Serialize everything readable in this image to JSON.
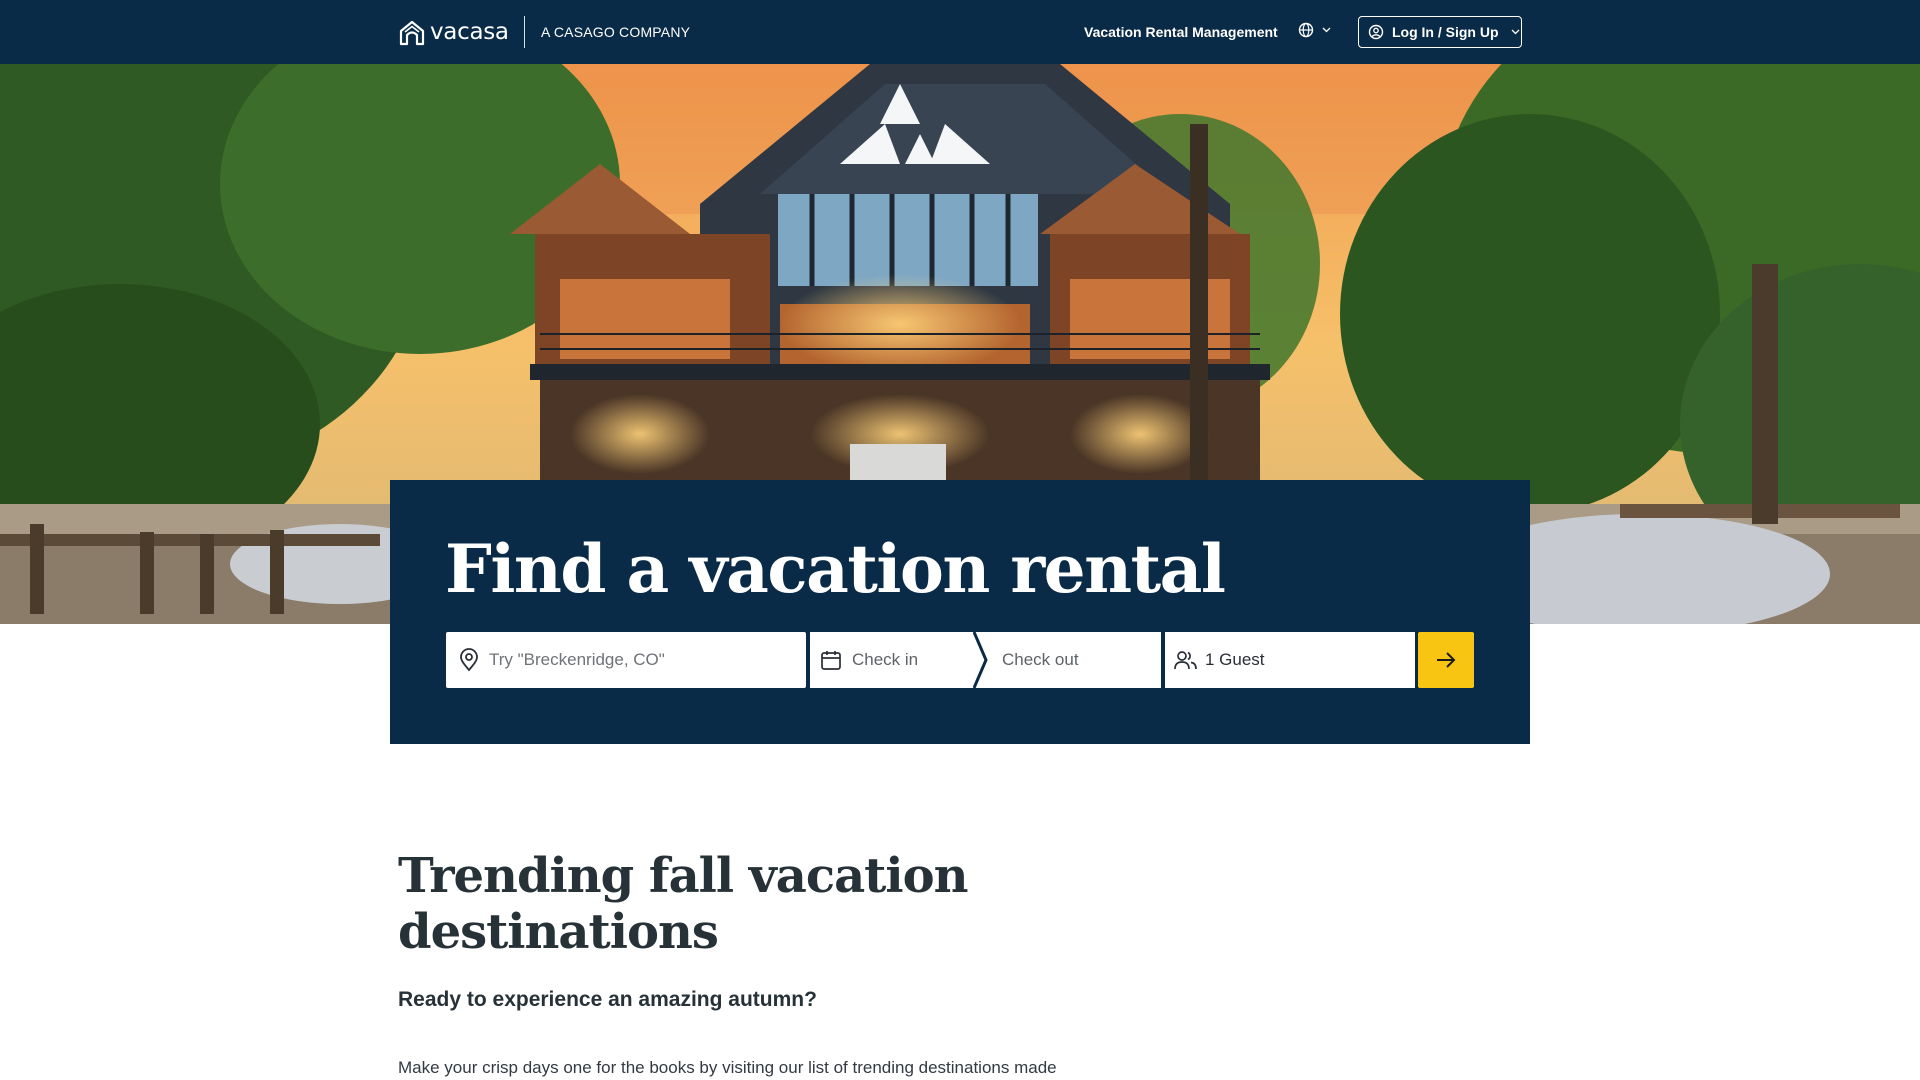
{
  "header": {
    "logo_text": "vacasa",
    "tagline": "A CASAGO COMPANY",
    "nav_link": "Vacation Rental Management",
    "login_label": "Log In / Sign Up"
  },
  "hero": {
    "title": "Find a vacation rental",
    "search": {
      "location_placeholder": "Try \"Breckenridge, CO\"",
      "check_in_label": "Check in",
      "check_out_label": "Check out",
      "guests_value": "1 Guest"
    }
  },
  "content": {
    "title": "Trending fall vacation destinations",
    "subtitle": "Ready to experience an amazing autumn?",
    "body": "Make your crisp days one for the books by visiting our list of trending destinations made"
  },
  "colors": {
    "navy": "#0a2b47",
    "accent_yellow": "#f7c512"
  },
  "icons": [
    "house-logo-icon",
    "globe-icon",
    "chevron-down-icon",
    "user-circle-icon",
    "location-pin-icon",
    "calendar-icon",
    "guests-icon",
    "arrow-right-icon"
  ]
}
